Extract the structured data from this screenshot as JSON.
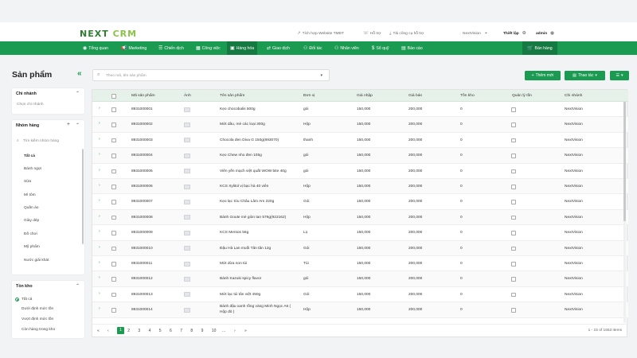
{
  "header": {
    "logo_main": "NEXT",
    "logo_accent": "CRM",
    "links": [
      {
        "label": "Tích hợp Website TMĐT",
        "icon": "link-icon"
      },
      {
        "label": "Hỗ trợ",
        "icon": "headset-icon"
      },
      {
        "label": "Tải công cụ hỗ trợ",
        "icon": "download-icon"
      }
    ],
    "branch": "NextVision",
    "settings_label": "Thiết lập",
    "user": "admin"
  },
  "nav": {
    "items": [
      {
        "label": "Tổng quan",
        "icon": "eye-icon"
      },
      {
        "label": "Marketing",
        "icon": "megaphone-icon"
      },
      {
        "label": "Chiến dịch",
        "icon": "list-icon"
      },
      {
        "label": "Công việc",
        "icon": "calendar-icon"
      },
      {
        "label": "Hàng hóa",
        "icon": "box-icon"
      },
      {
        "label": "Giao dịch",
        "icon": "exchange-icon"
      },
      {
        "label": "Đối tác",
        "icon": "users-icon"
      },
      {
        "label": "Nhân viên",
        "icon": "staff-icon"
      },
      {
        "label": "Sổ quỹ",
        "icon": "dollar-icon"
      },
      {
        "label": "Báo cáo",
        "icon": "chart-icon"
      }
    ],
    "sales_label": "Bán hàng"
  },
  "sidebar": {
    "title": "Sản phẩm",
    "branch_panel": {
      "title": "Chi nhánh",
      "placeholder": "Chọn chi nhánh"
    },
    "group_panel": {
      "title": "Nhóm hàng",
      "search_placeholder": "Tìm kiếm nhóm hàng",
      "items": [
        "Tất cả",
        "Bánh ngọt",
        "Sữa",
        "Mì tôm",
        "Quần áo",
        "Giày dép",
        "Đồ chơi",
        "Mỹ phẩm",
        "Nước giải khát"
      ]
    },
    "stock_panel": {
      "title": "Tồn kho",
      "options": [
        "Tất cả",
        "Dưới định mức tồn",
        "Vượt định mức tồn",
        "Còn hàng trong kho"
      ]
    }
  },
  "toolbar": {
    "search_placeholder": "Theo mã, tên sản phẩm",
    "add_label": "Thêm mới",
    "actions_label": "Thao tác"
  },
  "table": {
    "columns": [
      "Mã sản phẩm",
      "Ảnh",
      "Tên sản phẩm",
      "Đơn vị",
      "Giá nhập",
      "Giá bán",
      "Tồn kho",
      "Quản lý tồn",
      "Chi nhánh"
    ],
    "rows": [
      {
        "code": "8931000001",
        "name": "Kẹo chocobalis 500g",
        "unit": "gói",
        "cost": "150,000",
        "price": "200,000",
        "stock": "0",
        "branch": "NextVision"
      },
      {
        "code": "8931000002",
        "name": "Mứt dâu, mè các loại 300g",
        "unit": "Hộp",
        "cost": "150,000",
        "price": "200,000",
        "stock": "0",
        "branch": "NextVision"
      },
      {
        "code": "8931000003",
        "name": "Chocola đen Diva G 150g(893070)",
        "unit": "thanh",
        "cost": "150,000",
        "price": "200,000",
        "stock": "0",
        "branch": "NextVision"
      },
      {
        "code": "8931000004",
        "name": "Kẹo Chew nho đen 105g",
        "unit": "gói",
        "cost": "150,000",
        "price": "200,000",
        "stock": "0",
        "branch": "NextVision"
      },
      {
        "code": "8931000005",
        "name": "Viên yến mạch việt quất WOW bite 40g",
        "unit": "gói",
        "cost": "150,000",
        "price": "200,000",
        "stock": "0",
        "branch": "NextVision"
      },
      {
        "code": "8931000006",
        "name": "KCS Xylitol vị bạc hà 40 viên",
        "unit": "Hộp",
        "cost": "150,000",
        "price": "200,000",
        "stock": "0",
        "branch": "NextVision"
      },
      {
        "code": "8931000007",
        "name": "Kẹo lạc Sìu Châu Lâm Am 220g",
        "unit": "Gói",
        "cost": "150,000",
        "price": "200,000",
        "stock": "0",
        "branch": "NextVision"
      },
      {
        "code": "8931000008",
        "name": "Bánh Goute mè giòn tan 576g(922162)",
        "unit": "Hộp",
        "cost": "150,000",
        "price": "200,000",
        "stock": "0",
        "branch": "NextVision"
      },
      {
        "code": "8931000009",
        "name": "KCS Mentos 56g",
        "unit": "Lọ",
        "cost": "150,000",
        "price": "200,000",
        "stock": "0",
        "branch": "NextVision"
      },
      {
        "code": "8931000010",
        "name": "Đậu Hà Lan muối Tân tân 12g",
        "unit": "Gói",
        "cost": "150,000",
        "price": "200,000",
        "stock": "0",
        "branch": "NextVision"
      },
      {
        "code": "8931000011",
        "name": "Mứt dừa non túi",
        "unit": "Túi",
        "cost": "150,000",
        "price": "200,000",
        "stock": "0",
        "branch": "NextVision"
      },
      {
        "code": "8931000012",
        "name": "Bánh Kazuki spicy flavor",
        "unit": "gói",
        "cost": "150,000",
        "price": "200,000",
        "stock": "0",
        "branch": "NextVision"
      },
      {
        "code": "8931000013",
        "name": "Mứt lạc túi tân việt 450g",
        "unit": "Gói",
        "cost": "150,000",
        "price": "200,000",
        "stock": "0",
        "branch": "NextVision"
      },
      {
        "code": "8931000014",
        "name": "Bánh đậu xanh rồng vàng Minh Ngọc A6 ( Hộp đỏ )",
        "unit": "Hộp",
        "cost": "150,000",
        "price": "200,000",
        "stock": "0",
        "branch": "NextVision"
      }
    ]
  },
  "pager": {
    "pages": [
      "1",
      "2",
      "3",
      "4",
      "5",
      "6",
      "7",
      "8",
      "9",
      "10",
      "..."
    ],
    "first": "«",
    "prev": "‹",
    "next": "›",
    "last": "»",
    "info": "1 - 15 of 1553 items"
  },
  "colors": {
    "brand": "#1b9a52",
    "brand_dark": "#157a41"
  }
}
